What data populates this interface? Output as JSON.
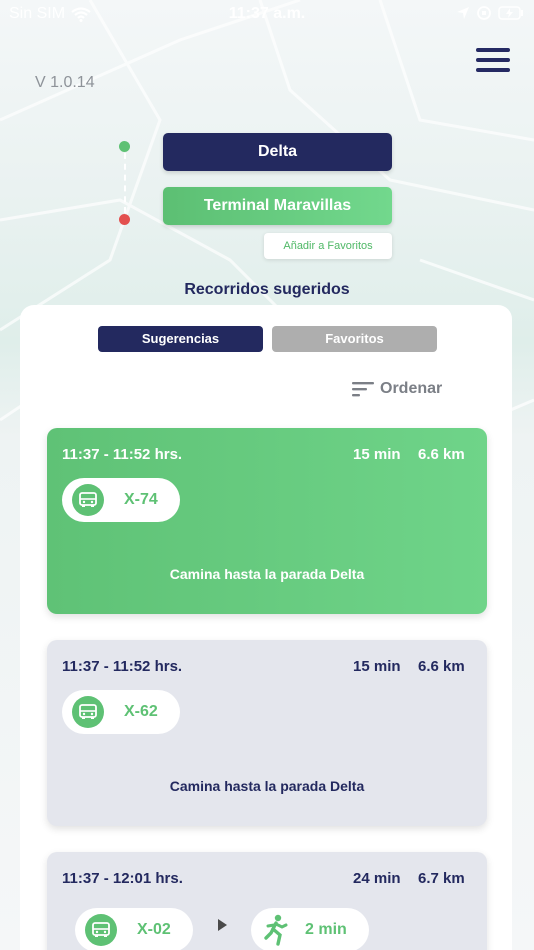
{
  "status_bar": {
    "carrier": "Sin SIM",
    "time": "11:37 a.m."
  },
  "header": {
    "version": "V 1.0.14"
  },
  "route": {
    "origin": "Delta",
    "destination": "Terminal Maravillas",
    "add_favorite": "Añadir a Favoritos"
  },
  "suggestions": {
    "title": "Recorridos sugeridos",
    "tab_suggestions": "Sugerencias",
    "tab_favorites": "Favoritos",
    "sort_label": "Ordenar"
  },
  "routes": [
    {
      "time": "11:37 - 11:52 hrs.",
      "duration": "15 min",
      "distance": "6.6 km",
      "bus": "X-74",
      "walk": "Camina hasta la parada Delta"
    },
    {
      "time": "11:37 - 11:52 hrs.",
      "duration": "15 min",
      "distance": "6.6 km",
      "bus": "X-62",
      "walk": "Camina hasta la parada Delta"
    },
    {
      "time": "11:37 - 12:01 hrs.",
      "duration": "24 min",
      "distance": "6.7 km",
      "bus": "X-02",
      "walk_time": "2 min"
    }
  ],
  "colors": {
    "navy": "#23295f",
    "green": "#5ec174",
    "red": "#e3504f",
    "card_grey": "#e4e6ed"
  },
  "icons": [
    "wifi-icon",
    "location-icon",
    "battery-icon",
    "menu-icon",
    "sort-icon",
    "bus-icon",
    "walk-icon",
    "arrow-right-icon"
  ]
}
